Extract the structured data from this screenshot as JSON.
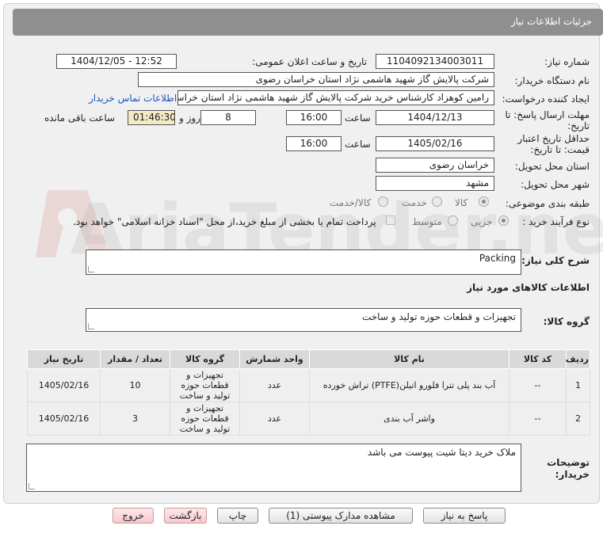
{
  "header": {
    "title": "جزئیات اطلاعات نیاز"
  },
  "watermark": {
    "text": "AriaTender.net"
  },
  "fields": {
    "need_number_label": "شماره نیاز:",
    "need_number": "1104092134003011",
    "announce_label": "تاریخ و ساعت اعلان عمومی:",
    "announce_value": "1404/12/05 - 12:52",
    "buyer_label": "نام دستگاه خریدار:",
    "buyer_value": "شرکت پالایش گاز شهید هاشمی نژاد   استان خراسان رضوی",
    "creator_label": "ایجاد کننده درخواست:",
    "creator_value": "رامین کوهزاد کارشناس خرید شرکت پالایش گاز شهید هاشمی نژاد   استان خراسان رضوی",
    "contact_link": "اطلاعات تماس خریدار",
    "deadline_label_1": "مهلت ارسال پاسخ: تا",
    "deadline_label_2": "تاریخ:",
    "deadline_date": "1404/12/13",
    "time_label": "ساعت",
    "deadline_time": "16:00",
    "days_value": "8",
    "days_label": "روز و",
    "remaining_time": "01:46:30",
    "remaining_label": "ساعت باقی مانده",
    "validity_label_1": "حداقل تاریخ اعتبار",
    "validity_label_2": "قیمت: تا تاریخ:",
    "validity_date": "1405/02/16",
    "validity_time": "16:00",
    "province_label": "استان محل تحویل:",
    "province_value": "خراسان رضوی",
    "city_label": "شهر محل تحویل:",
    "city_value": "مشهد",
    "category_label": "طبقه بندی موضوعی:",
    "category_options": [
      "کالا",
      "خدمت",
      "کالا/خدمت"
    ],
    "process_label": "نوع فرآیند خرید :",
    "process_options": [
      "جزیی",
      "متوسط"
    ],
    "payment_note": "پرداخت تمام یا بخشی از مبلغ خرید،از محل \"اسناد خزانه اسلامی\" خواهد بود.",
    "summary_label": "شرح کلی نیاز:",
    "summary_value": "Packing",
    "goods_info_title": "اطلاعات کالاهای مورد نیاز",
    "goods_group_label": "گروه کالا:",
    "goods_group_value": "تجهیزات و قطعات حوزه تولید و ساخت",
    "notes_label_1": "توضیحات",
    "notes_label_2": "خریدار:",
    "notes_value": "ملاک خرید دیتا شیت پیوست می باشد"
  },
  "table": {
    "headers": [
      "ردیف",
      "کد کالا",
      "نام کالا",
      "واحد شمارش",
      "گروه کالا",
      "تعداد / مقدار",
      "تاریخ نیاز"
    ],
    "rows": [
      [
        "1",
        "--",
        "آب بند پلی تترا فلورو اتیلن(PTFE) تراش خورده",
        "عدد",
        "تجهیزات و قطعات حوزه تولید و ساخت",
        "10",
        "1405/02/16"
      ],
      [
        "2",
        "--",
        "واشر آب بندی",
        "عدد",
        "تجهیزات و قطعات حوزه تولید و ساخت",
        "3",
        "1405/02/16"
      ]
    ]
  },
  "buttons": {
    "reply": "پاسخ به نیاز",
    "attachments": "مشاهده مدارک پیوستی (1)",
    "print": "چاپ",
    "back": "بازگشت",
    "exit": "خروج"
  },
  "colors": {
    "header_bg": "#8f8f8f",
    "time_bg": "#f3e9c6",
    "link": "#1a56c7"
  }
}
